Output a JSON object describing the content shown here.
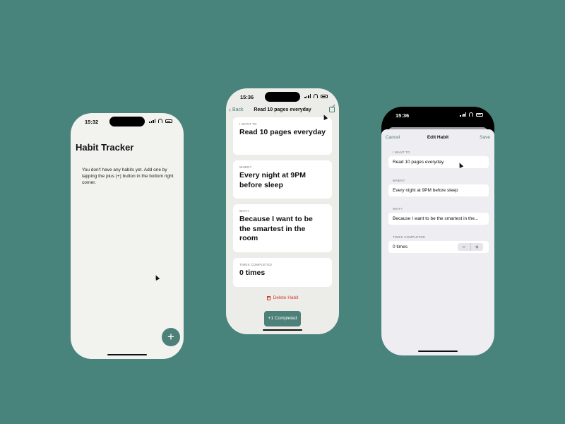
{
  "phone1": {
    "time": "15:32",
    "title": "Habit Tracker",
    "empty_message": "You don't have any habits yet. Add one by tapping the plus (+) button in the bottom right corner.",
    "fab_label": "+"
  },
  "phone2": {
    "time": "15:36",
    "back_label": "Back",
    "nav_title": "Read 10 pages everyday",
    "cards": [
      {
        "label": "I WANT TO",
        "value": "Read 10 pages everyday"
      },
      {
        "label": "WHEN?",
        "value": "Every night at 9PM before sleep"
      },
      {
        "label": "WHY?",
        "value": "Because I want to be the smartest in the room"
      },
      {
        "label": "TIMES COMPLETED",
        "value": "0 times"
      }
    ],
    "delete_label": "Delete Habit",
    "complete_label": "+1 Completed"
  },
  "phone3": {
    "time": "15:36",
    "cancel_label": "Cancel",
    "nav_title": "Edit Habit",
    "save_label": "Save",
    "fields": [
      {
        "label": "I WANT TO",
        "value": "Read 10 pages everyday"
      },
      {
        "label": "WHEN?",
        "value": "Every night at 9PM before sleep"
      },
      {
        "label": "WHY?",
        "value": "Because I want to be the smartest in the..."
      },
      {
        "label": "TIMES COMPLETED",
        "value": "0 times"
      }
    ],
    "stepper_minus": "−",
    "stepper_plus": "+"
  },
  "colors": {
    "background": "#48837c",
    "accent": "#4d8079",
    "destructive": "#d23b30"
  }
}
